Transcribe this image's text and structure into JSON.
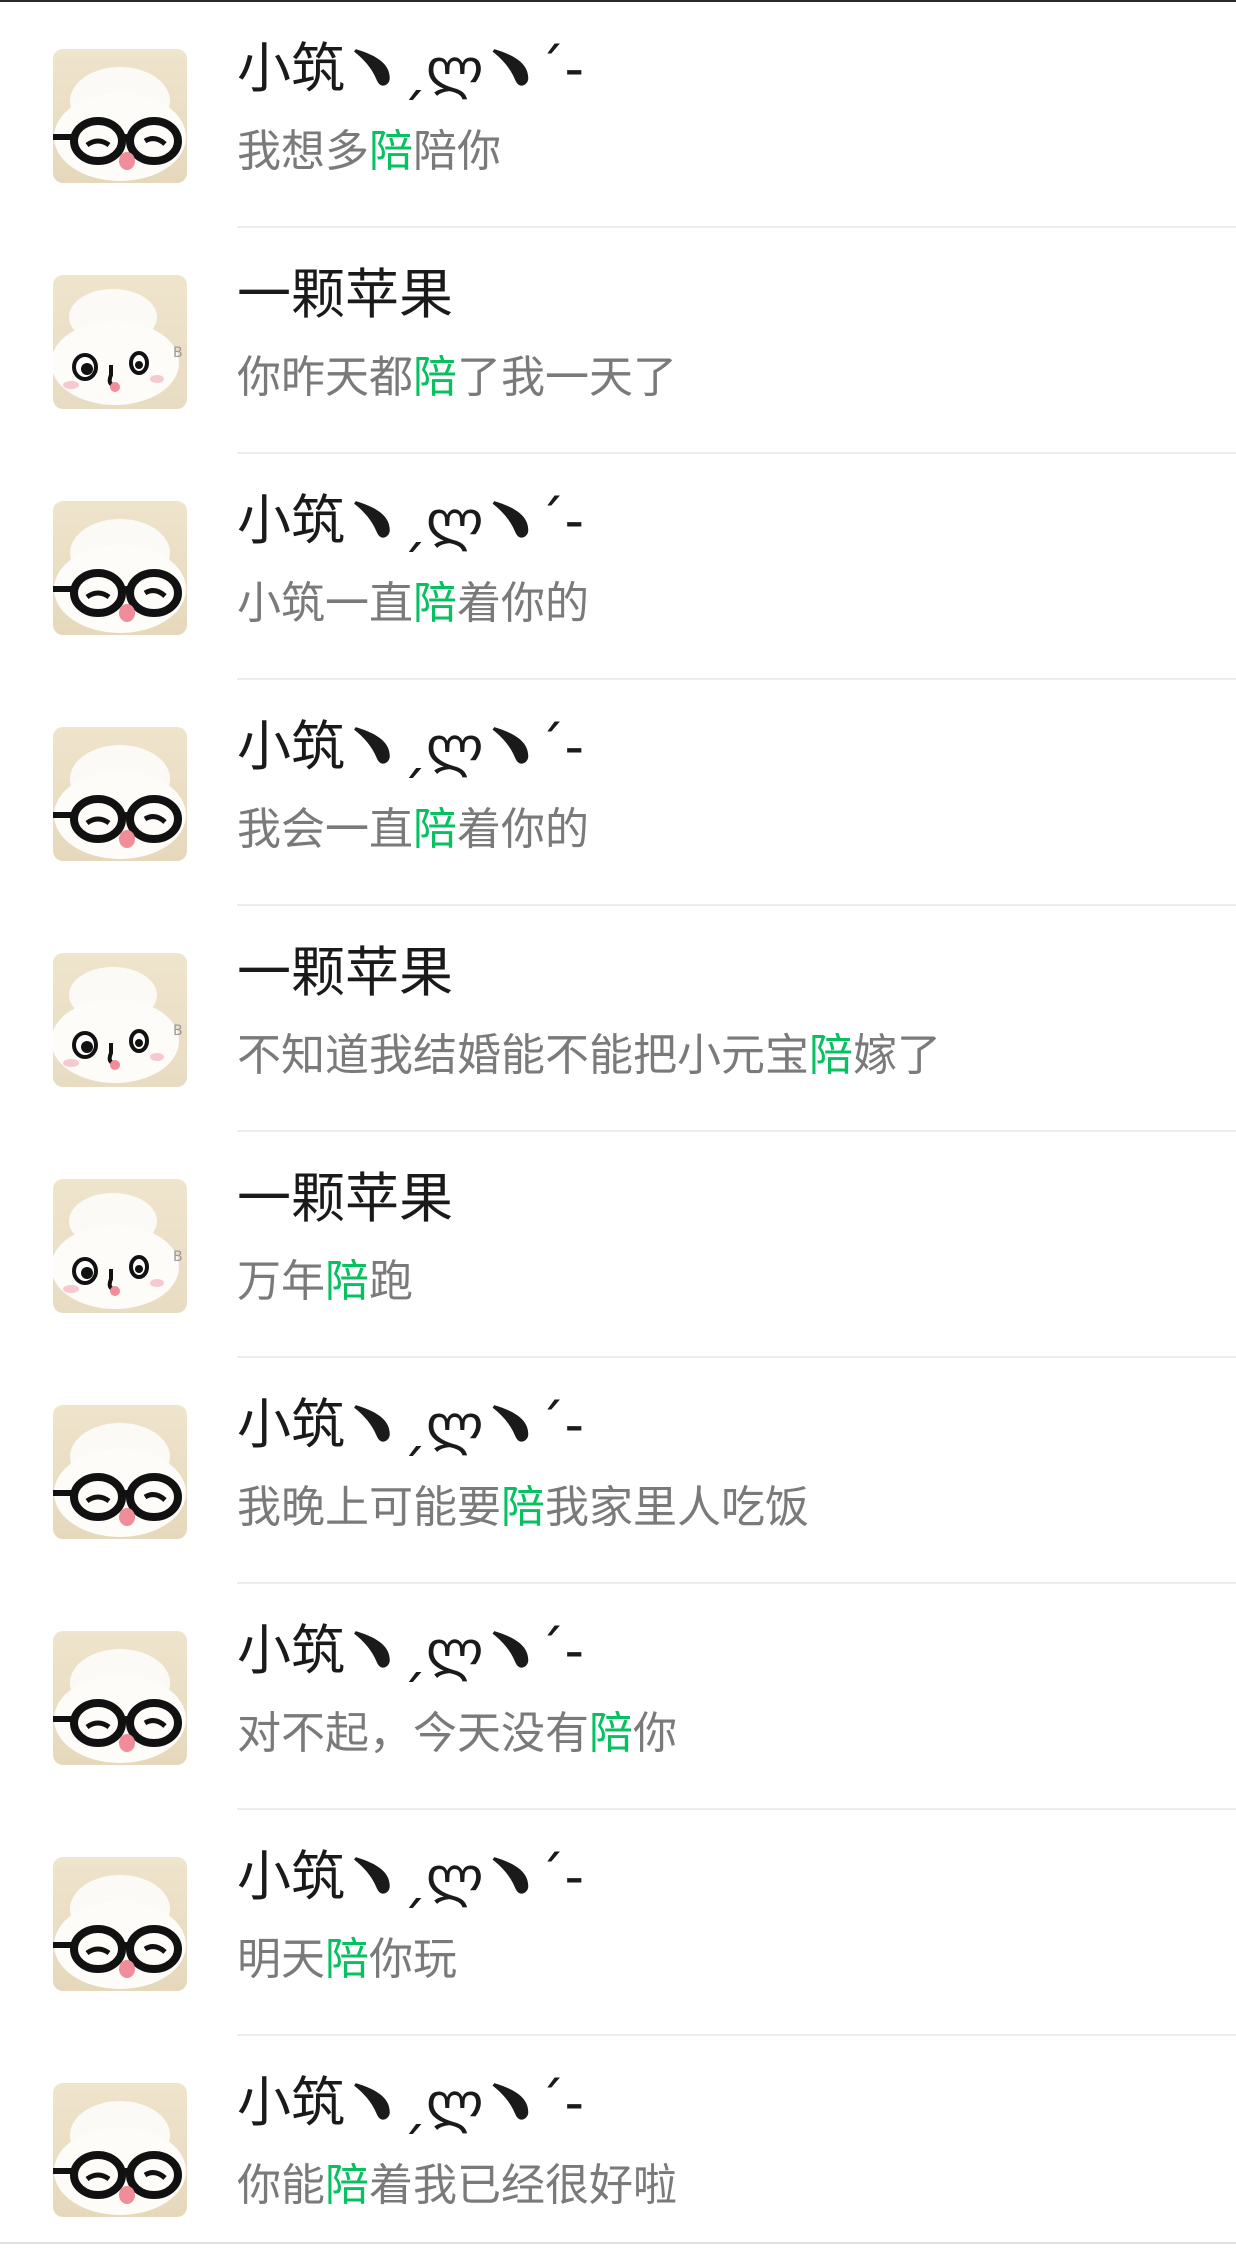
{
  "chats": [
    {
      "sender": "小筑﹅ˏლ﹅ˊ-",
      "avatar": "glasses-bun-avatar",
      "pre": "我想多",
      "hl": "陪",
      "post": "陪你"
    },
    {
      "sender": "一颗苹果",
      "avatar": "bun-face-avatar",
      "pre": "你昨天都",
      "hl": "陪",
      "post": "了我一天了"
    },
    {
      "sender": "小筑﹅ˏლ﹅ˊ-",
      "avatar": "glasses-bun-avatar",
      "pre": "小筑一直",
      "hl": "陪",
      "post": "着你的"
    },
    {
      "sender": "小筑﹅ˏლ﹅ˊ-",
      "avatar": "glasses-bun-avatar",
      "pre": "我会一直",
      "hl": "陪",
      "post": "着你的"
    },
    {
      "sender": "一颗苹果",
      "avatar": "bun-face-avatar",
      "pre": "不知道我结婚能不能把小元宝",
      "hl": "陪",
      "post": "嫁了"
    },
    {
      "sender": "一颗苹果",
      "avatar": "bun-face-avatar",
      "pre": "万年",
      "hl": "陪",
      "post": "跑"
    },
    {
      "sender": "小筑﹅ˏლ﹅ˊ-",
      "avatar": "glasses-bun-avatar",
      "pre": "我晚上可能要",
      "hl": "陪",
      "post": "我家里人吃饭"
    },
    {
      "sender": "小筑﹅ˏლ﹅ˊ-",
      "avatar": "glasses-bun-avatar",
      "pre": "对不起，今天没有",
      "hl": "陪",
      "post": "你"
    },
    {
      "sender": "小筑﹅ˏლ﹅ˊ-",
      "avatar": "glasses-bun-avatar",
      "pre": "明天",
      "hl": "陪",
      "post": "你玩"
    },
    {
      "sender": "小筑﹅ˏლ﹅ˊ-",
      "avatar": "glasses-bun-avatar",
      "pre": "你能",
      "hl": "陪",
      "post": "着我已经很好啦"
    }
  ],
  "colors": {
    "highlight": "#07c160",
    "message_text": "#7a7a7a",
    "name_text": "#1a1a1a",
    "divider": "#ececec"
  }
}
